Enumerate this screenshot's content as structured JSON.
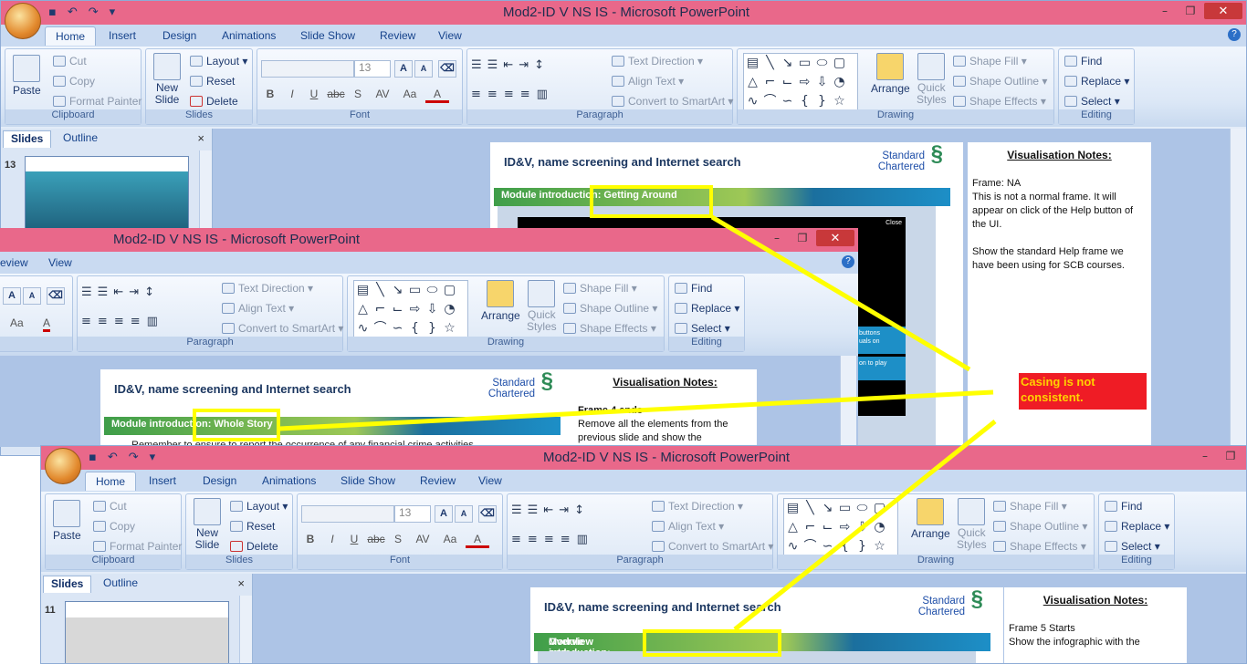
{
  "windows": {
    "top": {
      "title": "Mod2-ID V NS IS - Microsoft PowerPoint"
    },
    "mid": {
      "title": "Mod2-ID V NS IS - Microsoft PowerPoint"
    },
    "bottom": {
      "title": "Mod2-ID V NS IS - Microsoft PowerPoint"
    }
  },
  "tabs": [
    "Home",
    "Insert",
    "Design",
    "Animations",
    "Slide Show",
    "Review",
    "View"
  ],
  "mid_tabs": [
    "eview",
    "View"
  ],
  "ribbon": {
    "clipboard": {
      "paste": "Paste",
      "cut": "Cut",
      "copy": "Copy",
      "format_painter": "Format Painter",
      "label": "Clipboard"
    },
    "slides": {
      "new_slide": "New",
      "new_slide2": "Slide",
      "layout": "Layout",
      "reset": "Reset",
      "delete": "Delete",
      "label": "Slides"
    },
    "font": {
      "size": "13",
      "label": "Font"
    },
    "paragraph": {
      "text_direction": "Text Direction",
      "align_text": "Align Text",
      "convert": "Convert to SmartArt",
      "label": "Paragraph"
    },
    "drawing": {
      "arrange": "Arrange",
      "quick": "Quick",
      "styles": "Styles",
      "shape_fill": "Shape Fill",
      "shape_outline": "Shape Outline",
      "shape_effects": "Shape Effects",
      "label": "Drawing"
    },
    "editing": {
      "find": "Find",
      "replace": "Replace",
      "select": "Select",
      "label": "Editing"
    }
  },
  "panes": {
    "slides_tab": "Slides",
    "outline_tab": "Outline",
    "close": "×",
    "top_slide_num": "13",
    "bottom_slide_num": "11"
  },
  "slide": {
    "title": "ID&V, name screening and Internet search",
    "logo_line1": "Standard",
    "logo_line2": "Chartered",
    "top_bar": "Module introduction: Getting Around",
    "mid_bar": "Module introduction: Whole Story",
    "bottom_bar_prefix": "Module introduction:",
    "bottom_bar_highlight": "Overview and objectives",
    "close_label": "Close",
    "blue_btn1_line1": "buttons",
    "blue_btn1_line2": "uals on",
    "blue_btn2": "on to play",
    "mid_body": "Remember to ensure to report the occurrence of any financial crime activities"
  },
  "notes": {
    "heading": "Visualisation Notes:",
    "top": [
      "Frame: NA",
      "This is not a normal frame. It will appear on click of the Help button of the UI.",
      "",
      "Show the standard Help frame we have been using for SCB courses."
    ],
    "mid": [
      "Frame 4 ends",
      "Remove all the elements from the previous slide and show the"
    ],
    "bottom": [
      "Frame 5 Starts",
      "Show the infographic with the"
    ]
  },
  "annotation": {
    "text": "Casing is not consistent.",
    "color": "#ef1c25",
    "text_color": "#ffd200",
    "highlight_color": "#ffff00"
  }
}
